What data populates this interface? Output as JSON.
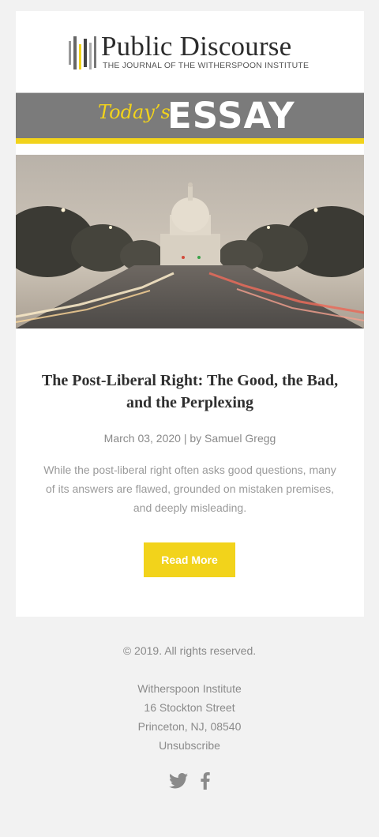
{
  "brand": {
    "name": "Public Discourse",
    "tagline": "THE JOURNAL OF THE WITHERSPOON INSTITUTE"
  },
  "banner": {
    "prefix": "Today’s",
    "label": "ESSAY",
    "accent_color": "#f2d31b",
    "background_color": "#7b7b7b"
  },
  "hero": {
    "icon": "capitol-dome-photo"
  },
  "article": {
    "title": "The Post-Liberal Right: The Good, the Bad, and the Perplexing",
    "date": "March 03, 2020",
    "separator": "| by",
    "author": "Samuel Gregg",
    "excerpt": "While the post-liberal right often asks good questions, many of its answers are flawed, grounded on mistaken premises, and deeply misleading.",
    "cta": "Read More"
  },
  "footer": {
    "copyright": "© 2019. All rights reserved.",
    "org": "Witherspoon Institute",
    "street": "16 Stockton Street",
    "city": "Princeton, NJ, 08540",
    "unsubscribe": "Unsubscribe",
    "social": [
      "twitter-icon",
      "facebook-icon"
    ]
  }
}
